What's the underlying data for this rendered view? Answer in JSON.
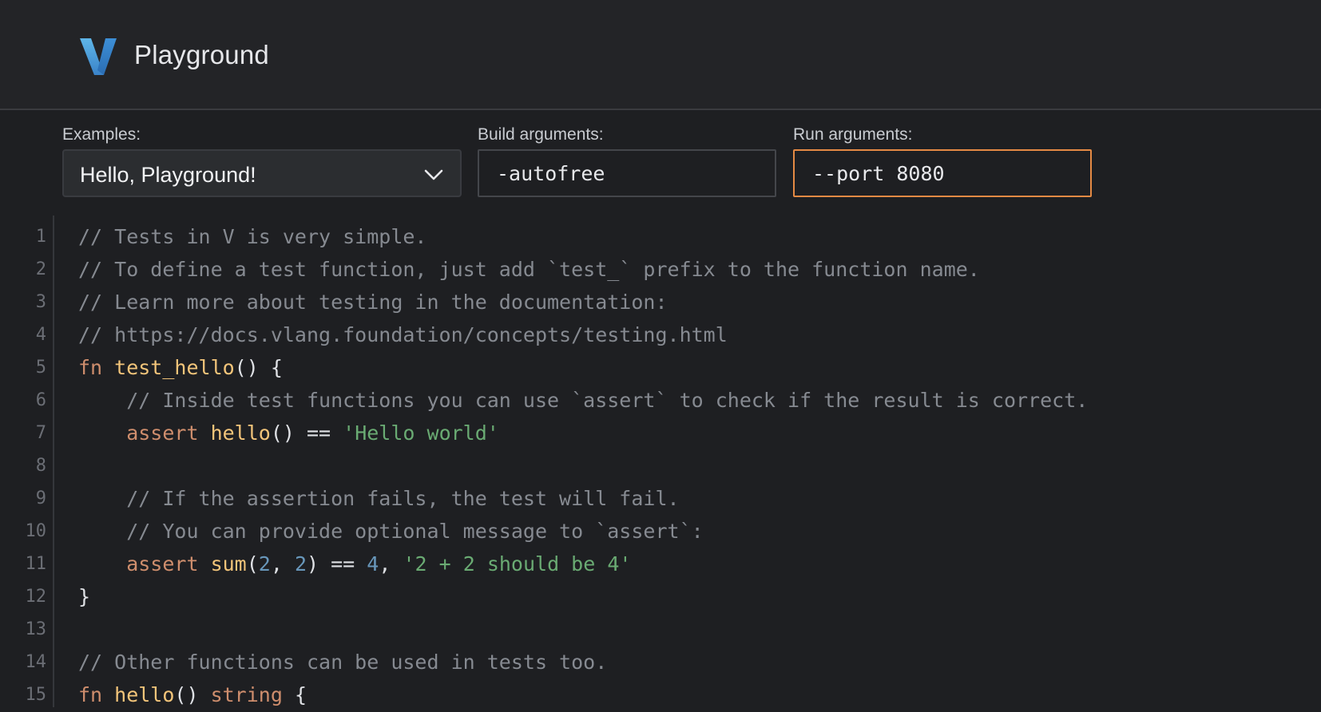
{
  "app": {
    "title": "Playground"
  },
  "examples": {
    "label": "Examples:",
    "selected": "Hello, Playground!"
  },
  "build_args": {
    "label": "Build arguments:",
    "value": "-autofree"
  },
  "run_args": {
    "label": "Run arguments:",
    "value": "--port 8080"
  },
  "colors": {
    "comment": "#868a91",
    "keyword": "#cf8e6d",
    "function": "#f3c57a",
    "string": "#6aab73",
    "number": "#6897bb",
    "plain": "#dfe1e5",
    "focus_border": "#e58a44"
  },
  "editor": {
    "lines": [
      {
        "n": "1",
        "tokens": [
          [
            "comment",
            "// Tests in V is very simple."
          ]
        ]
      },
      {
        "n": "2",
        "tokens": [
          [
            "comment",
            "// To define a test function, just add `test_` prefix to the function name."
          ]
        ]
      },
      {
        "n": "3",
        "tokens": [
          [
            "comment",
            "// Learn more about testing in the documentation:"
          ]
        ]
      },
      {
        "n": "4",
        "tokens": [
          [
            "comment",
            "// https://docs.vlang.foundation/concepts/testing.html"
          ]
        ]
      },
      {
        "n": "5",
        "tokens": [
          [
            "kw",
            "fn "
          ],
          [
            "fn",
            "test_hello"
          ],
          [
            "plain",
            "() {"
          ]
        ]
      },
      {
        "n": "6",
        "tokens": [
          [
            "comment",
            "    // Inside test functions you can use `assert` to check if the result is correct."
          ]
        ]
      },
      {
        "n": "7",
        "tokens": [
          [
            "kw",
            "    assert "
          ],
          [
            "fn",
            "hello"
          ],
          [
            "plain",
            "() == "
          ],
          [
            "str",
            "'Hello world'"
          ]
        ]
      },
      {
        "n": "8",
        "tokens": []
      },
      {
        "n": "9",
        "tokens": [
          [
            "comment",
            "    // If the assertion fails, the test will fail."
          ]
        ]
      },
      {
        "n": "10",
        "tokens": [
          [
            "comment",
            "    // You can provide optional message to `assert`:"
          ]
        ]
      },
      {
        "n": "11",
        "tokens": [
          [
            "kw",
            "    assert "
          ],
          [
            "fn",
            "sum"
          ],
          [
            "plain",
            "("
          ],
          [
            "num",
            "2"
          ],
          [
            "plain",
            ", "
          ],
          [
            "num",
            "2"
          ],
          [
            "plain",
            ") == "
          ],
          [
            "num",
            "4"
          ],
          [
            "plain",
            ", "
          ],
          [
            "str",
            "'2 + 2 should be 4'"
          ]
        ]
      },
      {
        "n": "12",
        "tokens": [
          [
            "plain",
            "}"
          ]
        ]
      },
      {
        "n": "13",
        "tokens": []
      },
      {
        "n": "14",
        "tokens": [
          [
            "comment",
            "// Other functions can be used in tests too."
          ]
        ]
      },
      {
        "n": "15",
        "tokens": [
          [
            "kw",
            "fn "
          ],
          [
            "fn",
            "hello"
          ],
          [
            "plain",
            "() "
          ],
          [
            "kw",
            "string"
          ],
          [
            "plain",
            " {"
          ]
        ]
      }
    ]
  }
}
